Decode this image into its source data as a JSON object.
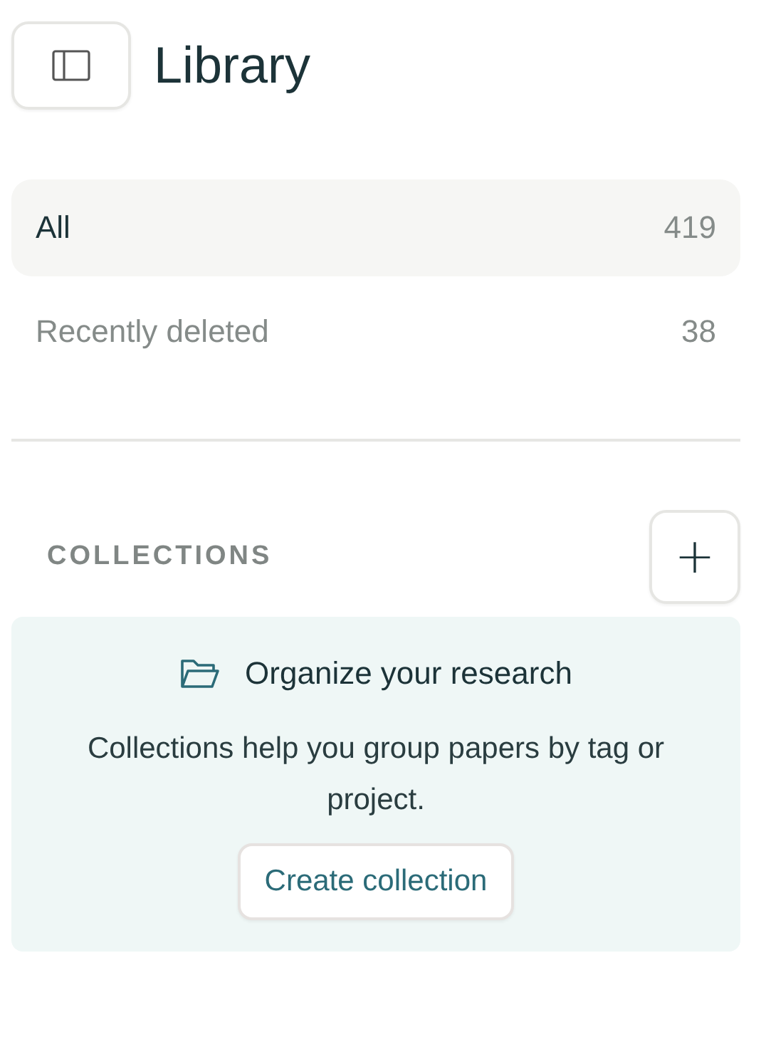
{
  "header": {
    "title": "Library"
  },
  "nav": [
    {
      "label": "All",
      "count": "419",
      "selected": true
    },
    {
      "label": "Recently deleted",
      "count": "38",
      "selected": false
    }
  ],
  "collections": {
    "heading": "COLLECTIONS",
    "add_button": "+",
    "empty_state": {
      "title": "Organize your research",
      "body": "Collections help you group papers by tag or project.",
      "button": "Create collection"
    }
  }
}
